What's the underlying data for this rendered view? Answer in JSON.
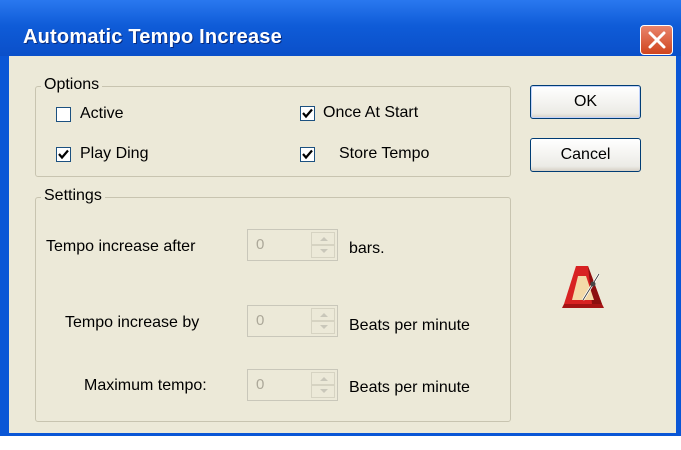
{
  "window": {
    "title": "Automatic Tempo Increase"
  },
  "options": {
    "group_label": "Options",
    "active": {
      "label": "Active",
      "checked": false
    },
    "play_ding": {
      "label": "Play Ding",
      "checked": true
    },
    "once_at_start": {
      "label": "Once At Start",
      "checked": true
    },
    "store_tempo": {
      "label": "Store Tempo",
      "checked": true
    }
  },
  "settings": {
    "group_label": "Settings",
    "increase_after": {
      "label": "Tempo increase after",
      "value": "0",
      "unit": "bars."
    },
    "increase_by": {
      "label": "Tempo increase by",
      "value": "0",
      "unit": "Beats per minute"
    },
    "maximum_tempo": {
      "label": "Maximum tempo:",
      "value": "0",
      "unit": "Beats per minute"
    }
  },
  "buttons": {
    "ok_label": "OK",
    "cancel_label": "Cancel"
  },
  "icons": {
    "close": "close-icon",
    "metronome": "metronome-icon",
    "spin_up": "arrow-up-icon",
    "spin_down": "arrow-down-icon",
    "check": "checkmark-icon"
  },
  "colors": {
    "title_bar": "#0a56d6",
    "dialog_face": "#ece9d8",
    "close_button": "#d8532c",
    "metronome": "#d22020"
  }
}
